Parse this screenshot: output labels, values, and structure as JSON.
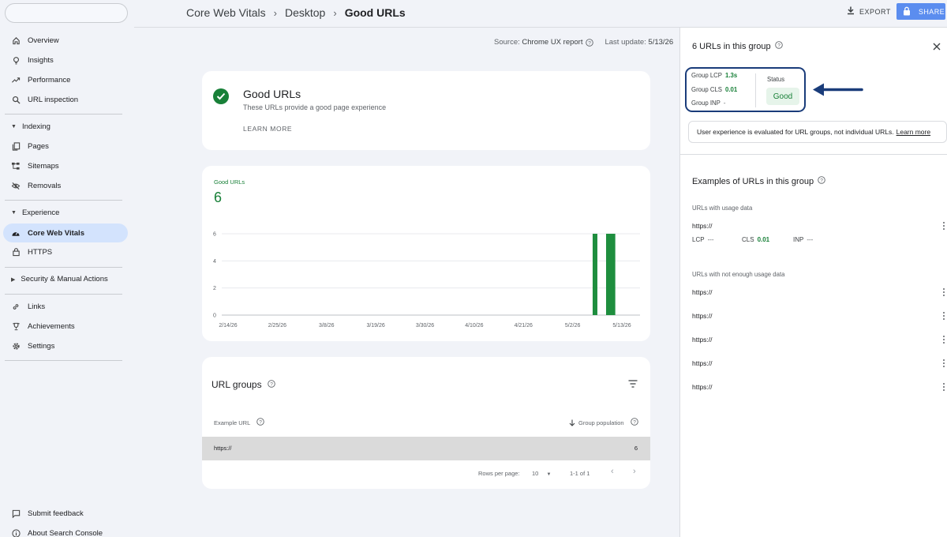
{
  "breadcrumb": [
    "Core Web Vitals",
    "Desktop",
    "Good URLs"
  ],
  "header": {
    "export_label": "EXPORT",
    "share_label": "SHARE"
  },
  "sidebar": {
    "items": [
      {
        "label": "Overview",
        "icon": "home-icon"
      },
      {
        "label": "Insights",
        "icon": "lightbulb-icon"
      },
      {
        "label": "Performance",
        "icon": "trending-up-icon"
      },
      {
        "label": "URL inspection",
        "icon": "search-icon"
      }
    ],
    "indexing": {
      "label": "Indexing",
      "items": [
        {
          "label": "Pages",
          "icon": "pages-icon"
        },
        {
          "label": "Sitemaps",
          "icon": "sitemap-icon"
        },
        {
          "label": "Removals",
          "icon": "visibility-off-icon"
        }
      ]
    },
    "experience": {
      "label": "Experience",
      "items": [
        {
          "label": "Core Web Vitals",
          "icon": "speed-icon"
        },
        {
          "label": "HTTPS",
          "icon": "lock-icon"
        }
      ]
    },
    "security_label": "Security & Manual Actions",
    "bottom_items": [
      {
        "label": "Links",
        "icon": "link-icon"
      },
      {
        "label": "Achievements",
        "icon": "trophy-icon"
      },
      {
        "label": "Settings",
        "icon": "gear-icon"
      }
    ],
    "footer_items": [
      {
        "label": "Submit feedback",
        "icon": "feedback-icon"
      },
      {
        "label": "About Search Console",
        "icon": "info-icon"
      }
    ]
  },
  "source": {
    "label": "Source:",
    "value": "Chrome UX report",
    "update_label": "Last update:",
    "update_value": "5/13/26"
  },
  "good_card": {
    "title": "Good URLs",
    "subtitle": "These URLs provide a good page experience",
    "learn_more": "LEARN MORE"
  },
  "metric": {
    "label": "Good URLs",
    "value": "6"
  },
  "chart_data": {
    "type": "bar",
    "title": "",
    "xlabel": "",
    "ylabel": "",
    "ylim": [
      0,
      6
    ],
    "yticks": [
      "0",
      "2",
      "4",
      "6"
    ],
    "x_tick_labels": [
      "2/14/26",
      "2/25/26",
      "3/8/26",
      "3/19/26",
      "3/30/26",
      "4/10/26",
      "4/21/26",
      "5/2/26",
      "5/13/26"
    ],
    "color": "#1e8e3e",
    "bars": [
      {
        "date": "5/7/26",
        "value": 6
      },
      {
        "date": "5/10/26",
        "value": 6
      },
      {
        "date": "5/11/26",
        "value": 6
      }
    ]
  },
  "url_groups": {
    "title": "URL groups",
    "col_example": "Example URL",
    "col_population": "Group population",
    "rows": [
      {
        "url": "https://",
        "population": "6"
      }
    ],
    "rows_per_page_label": "Rows per page:",
    "rows_per_page_value": "10",
    "range": "1-1 of 1"
  },
  "panel": {
    "title": "6 URLs in this group",
    "group_lcp_label": "Group LCP",
    "group_lcp_value": "1.3s",
    "group_cls_label": "Group CLS",
    "group_cls_value": "0.01",
    "group_inp_label": "Group INP",
    "group_inp_value": "-",
    "status_label": "Status",
    "status_value": "Good",
    "info_text": "User experience is evaluated for URL groups, not individual URLs.",
    "info_link": "Learn more",
    "examples_title": "Examples of URLs in this group",
    "with_data_label": "URLs with usage data",
    "with_data_url": "https://",
    "lcp_label": "LCP",
    "lcp_value": "---",
    "cls_label": "CLS",
    "cls_value": "0.01",
    "inp_label": "INP",
    "inp_value": "---",
    "not_enough_label": "URLs with not enough usage data",
    "not_enough_urls": [
      "https://",
      "https://",
      "https://",
      "https://",
      "https://"
    ]
  }
}
